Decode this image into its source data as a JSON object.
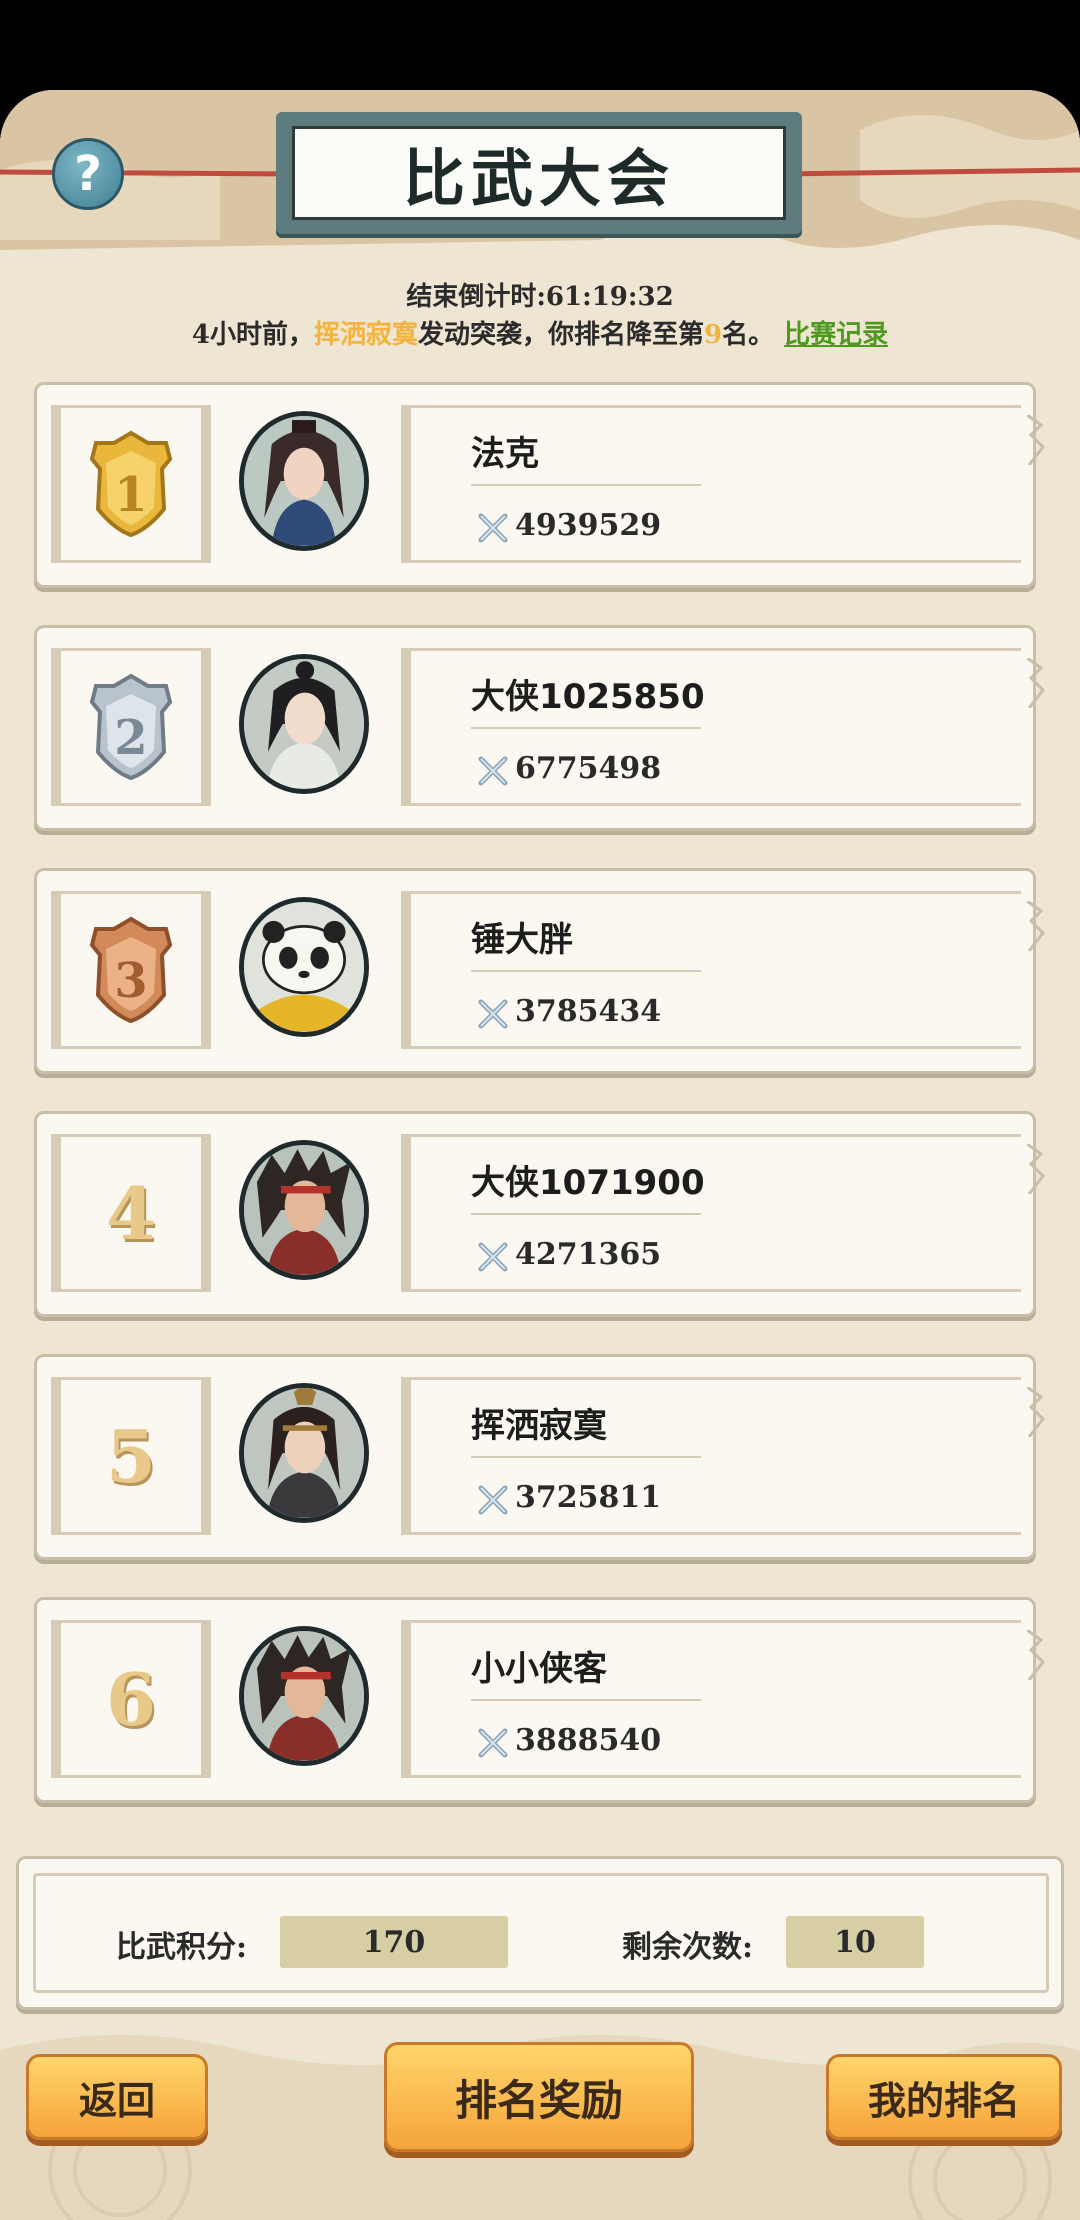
{
  "header": {
    "title": "比武大会",
    "help_label": "?"
  },
  "status": {
    "countdown_label": "结束倒计时:",
    "countdown_value": "61:19:32",
    "news_prefix": "4小时前，",
    "news_attacker": "挥洒寂寞",
    "news_middle": "发动突袭，你排名降至第",
    "news_rank": "9",
    "news_suffix": "名。",
    "record_link": "比赛记录"
  },
  "fight_label": "比武",
  "players": [
    {
      "rank": "1",
      "name": "法克",
      "power": "4939529"
    },
    {
      "rank": "2",
      "name": "大侠1025850",
      "power": "6775498"
    },
    {
      "rank": "3",
      "name": "锤大胖",
      "power": "3785434"
    },
    {
      "rank": "4",
      "name": "大侠1071900",
      "power": "4271365"
    },
    {
      "rank": "5",
      "name": "挥洒寂寞",
      "power": "3725811"
    },
    {
      "rank": "6",
      "name": "小小侠客",
      "power": "3888540"
    }
  ],
  "summary": {
    "points_label": "比武积分:",
    "points_value": "170",
    "remaining_label": "剩余次数:",
    "remaining_value": "10"
  },
  "buttons": {
    "back": "返回",
    "rewards": "排名奖励",
    "my_rank": "我的排名"
  },
  "colors": {
    "gold_medal": "#e8b73c",
    "silver_medal": "#b9c3cc",
    "bronze_medal": "#d28a5a",
    "highlight": "#f3b43f",
    "link": "#4e9a1e"
  }
}
